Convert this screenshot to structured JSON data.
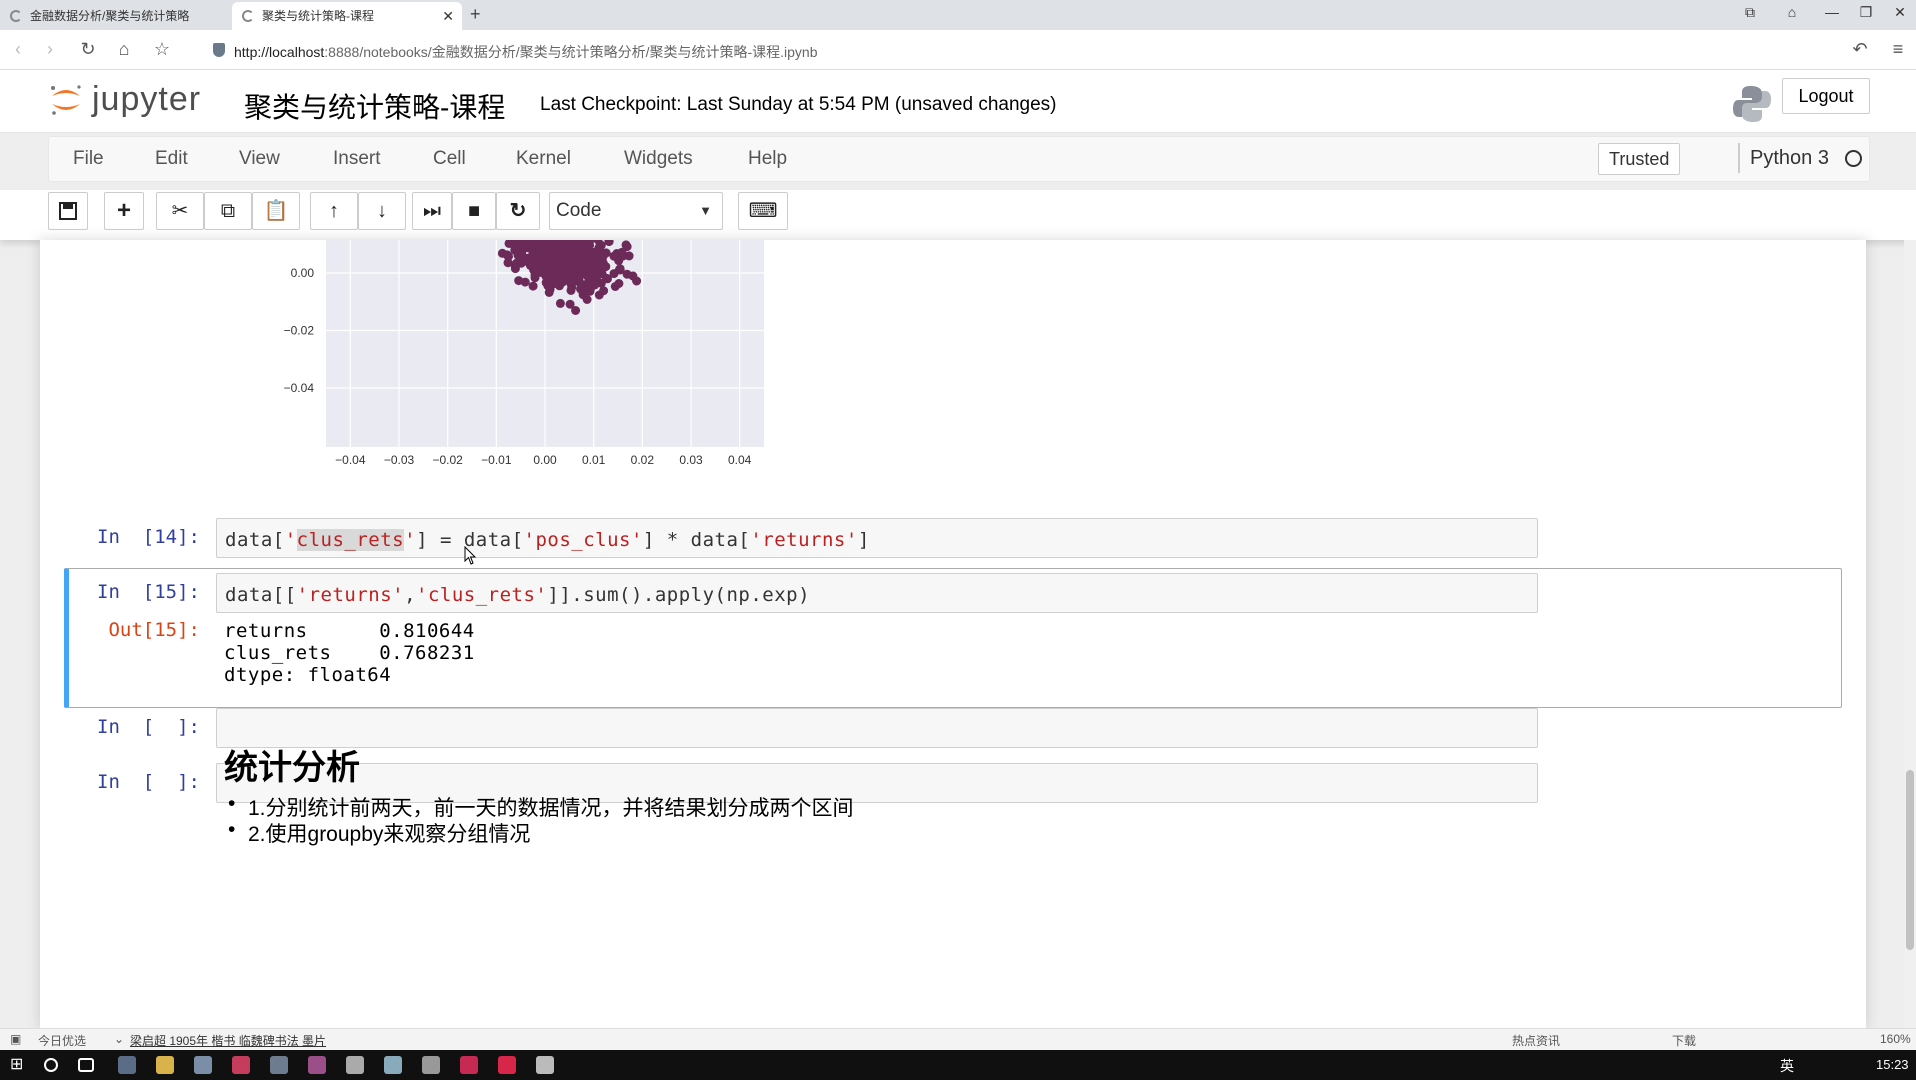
{
  "browser": {
    "tabs": [
      {
        "title": "金融数据分析/聚类与统计策略分",
        "active": false
      },
      {
        "title": "聚类与统计策略-课程",
        "active": true
      }
    ],
    "new_tab_label": "+",
    "url_host": "http://localhost",
    "url_rest": ":8888/notebooks/金融数据分析/聚类与统计策略分析/聚类与统计策略-课程.ipynb"
  },
  "jupyter": {
    "logo_text": "jupyter",
    "notebook_name": "聚类与统计策略-课程",
    "checkpoint": "Last Checkpoint: Last Sunday at 5:54 PM (unsaved changes)",
    "logout_label": "Logout",
    "menus": [
      "File",
      "Edit",
      "View",
      "Insert",
      "Cell",
      "Kernel",
      "Widgets",
      "Help"
    ],
    "trusted_label": "Trusted",
    "kernel_name": "Python 3",
    "cell_type": "Code"
  },
  "plot": {
    "point_color": "#6b2a58",
    "ytick_labels": [
      "0.00",
      "−0.02",
      "−0.04"
    ],
    "xtick_labels": [
      "−0.04",
      "−0.03",
      "−0.02",
      "−0.01",
      "0.00",
      "0.01",
      "0.02",
      "0.03",
      "0.04"
    ]
  },
  "cells": [
    {
      "prompt": "In  [14]:",
      "code_parts": [
        "data[",
        "'",
        "clus_rets",
        "'",
        "] = data[",
        "'pos_clus'",
        "] * data[",
        "'returns'",
        "]"
      ]
    },
    {
      "prompt": "In  [15]:",
      "code_parts": [
        "data[[",
        "'returns'",
        ",",
        "'clus_rets'",
        "]].sum().apply(np.exp)"
      ],
      "out_prompt": "Out[15]:",
      "output_lines": [
        "returns      0.810644",
        "clus_rets    0.768231",
        "dtype: float64"
      ]
    },
    {
      "prompt": "In  [  ]:"
    },
    {
      "prompt": "In  [  ]:"
    }
  ],
  "markdown": {
    "heading": "统计分析",
    "items": [
      "1.分别统计前两天，前一天的数据情况，并将结果划分成两个区间",
      "2.使用groupby来观察分组情况"
    ]
  },
  "statusbar": {
    "left": "今日优选",
    "news": "梁启超 1905年 楷书 临魏碑书法 墨片",
    "hot": "热点资讯",
    "download": "下载",
    "zoom": "160%"
  },
  "taskbar": {
    "ime": "英",
    "clock": "15:23"
  }
}
